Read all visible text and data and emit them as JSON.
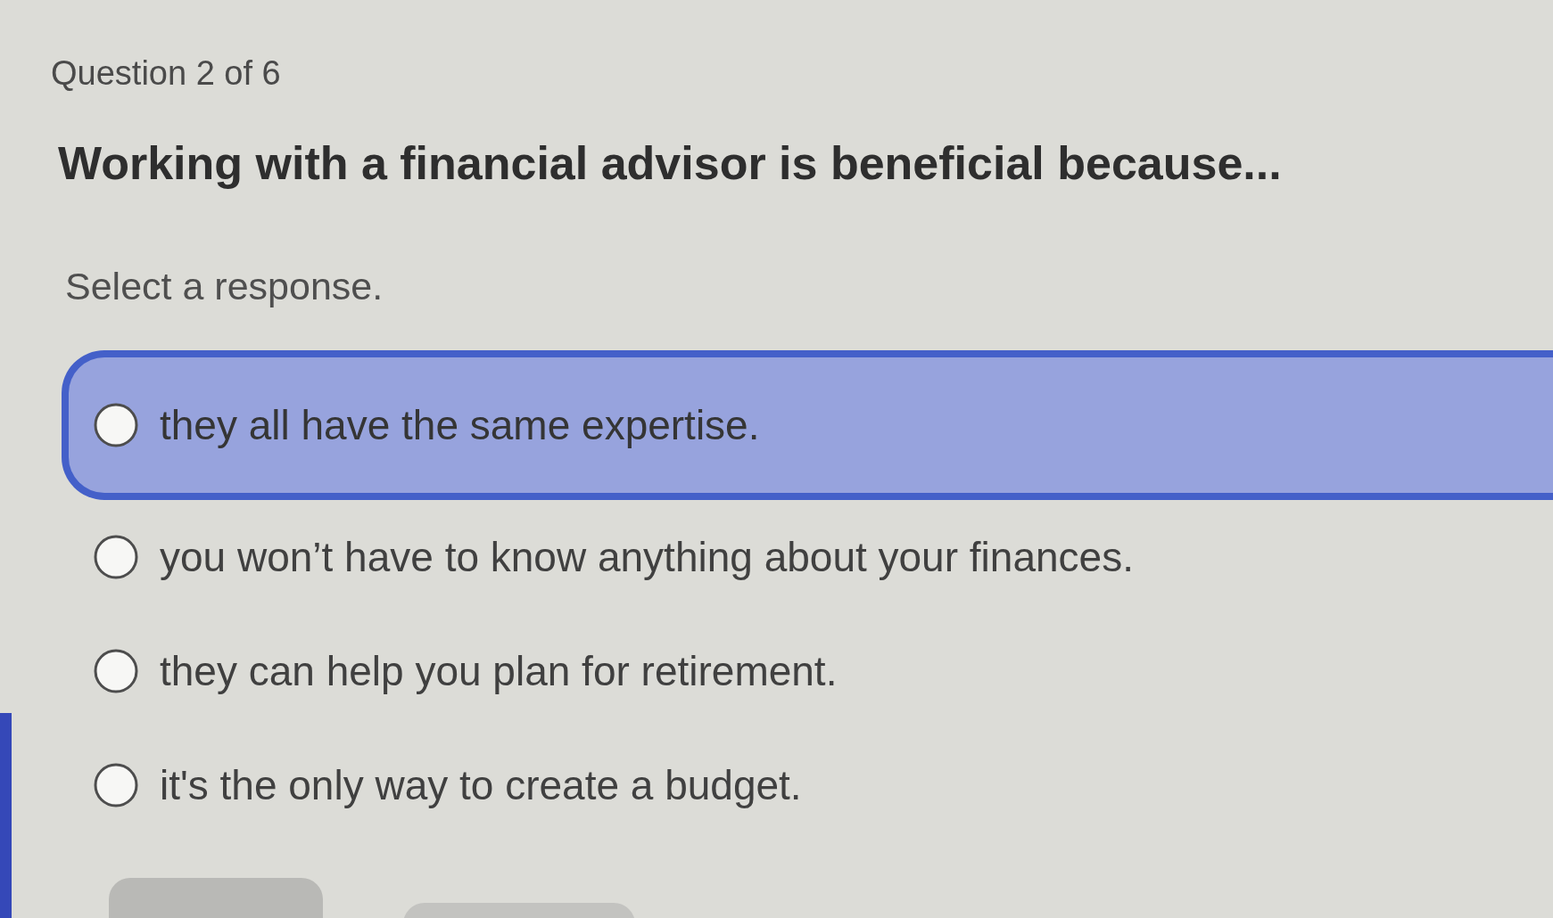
{
  "question_counter": "Question 2 of 6",
  "question": "Working with a financial advisor is beneficial because...",
  "instruction": "Select a response.",
  "options": [
    {
      "label": "they all have the same expertise.",
      "selected": false,
      "highlighted": true
    },
    {
      "label": "you won’t have to know anything about your finances.",
      "selected": false,
      "highlighted": false
    },
    {
      "label": "they can help you plan for retirement.",
      "selected": false,
      "highlighted": false
    },
    {
      "label": "it's the only way to create a budget.",
      "selected": false,
      "highlighted": false
    }
  ]
}
